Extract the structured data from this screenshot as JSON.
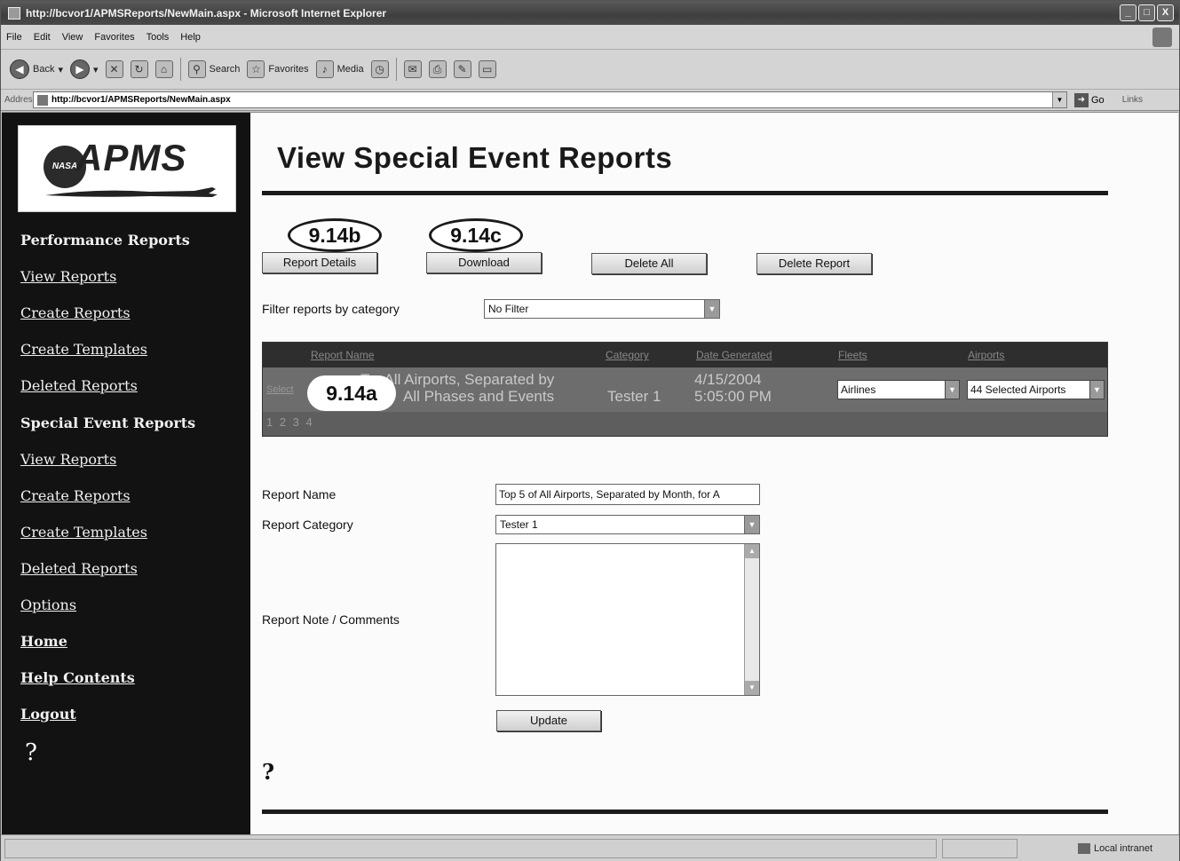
{
  "window": {
    "title": "http://bcvor1/APMSReports/NewMain.aspx - Microsoft Internet Explorer",
    "controls": [
      "_",
      "□",
      "X"
    ]
  },
  "menu": [
    "File",
    "Edit",
    "View",
    "Favorites",
    "Tools",
    "Help"
  ],
  "toolbar": {
    "back": "Back",
    "search": "Search",
    "favorites": "Favorites",
    "media": "Media"
  },
  "address": {
    "label": "Address",
    "url": "http://bcvor1/APMSReports/NewMain.aspx",
    "go": "Go",
    "links": "Links"
  },
  "sidebar": {
    "logo_text": "APMS",
    "nasa": "NASA",
    "items": [
      {
        "label": "Performance Reports"
      },
      {
        "label": "View Reports"
      },
      {
        "label": "Create Reports"
      },
      {
        "label": "Create Templates"
      },
      {
        "label": "Deleted Reports"
      },
      {
        "label": "Special Event Reports"
      },
      {
        "label": "View Reports"
      },
      {
        "label": "Create Reports"
      },
      {
        "label": "Create Templates"
      },
      {
        "label": "Deleted Reports"
      },
      {
        "label": "Options"
      },
      {
        "label": "Home"
      },
      {
        "label": "Help Contents"
      },
      {
        "label": "Logout"
      }
    ],
    "help": "?"
  },
  "main": {
    "title": "View Special Event Reports",
    "callouts": [
      "9.14b",
      "9.14c",
      "9.14a"
    ],
    "buttons": {
      "details": "Report Details",
      "download": "Download",
      "delete_all": "Delete All",
      "delete_report": "Delete Report",
      "update": "Update"
    },
    "filter": {
      "label": "Filter reports by category",
      "value": "No Filter"
    },
    "grid": {
      "headers": [
        "Report Name",
        "Category",
        "Date Generated",
        "Fleets",
        "Airports"
      ],
      "row": {
        "select": "Select",
        "name_line1": "T... All Airports, Separated by",
        "name_line2": "All Phases and Events",
        "category": "Tester 1",
        "date_line1": "4/15/2004",
        "date_line2": "5:05:00 PM",
        "fleet": "Airlines",
        "airports": "44 Selected Airports"
      },
      "pager": "1 2 3 4"
    },
    "form": {
      "name_label": "Report Name",
      "name_value": "Top 5 of All Airports, Separated by Month, for A",
      "category_label": "Report Category",
      "category_value": "Tester 1",
      "note_label": "Report Note / Comments"
    },
    "help": "?"
  },
  "status": {
    "zone": "Local intranet"
  }
}
